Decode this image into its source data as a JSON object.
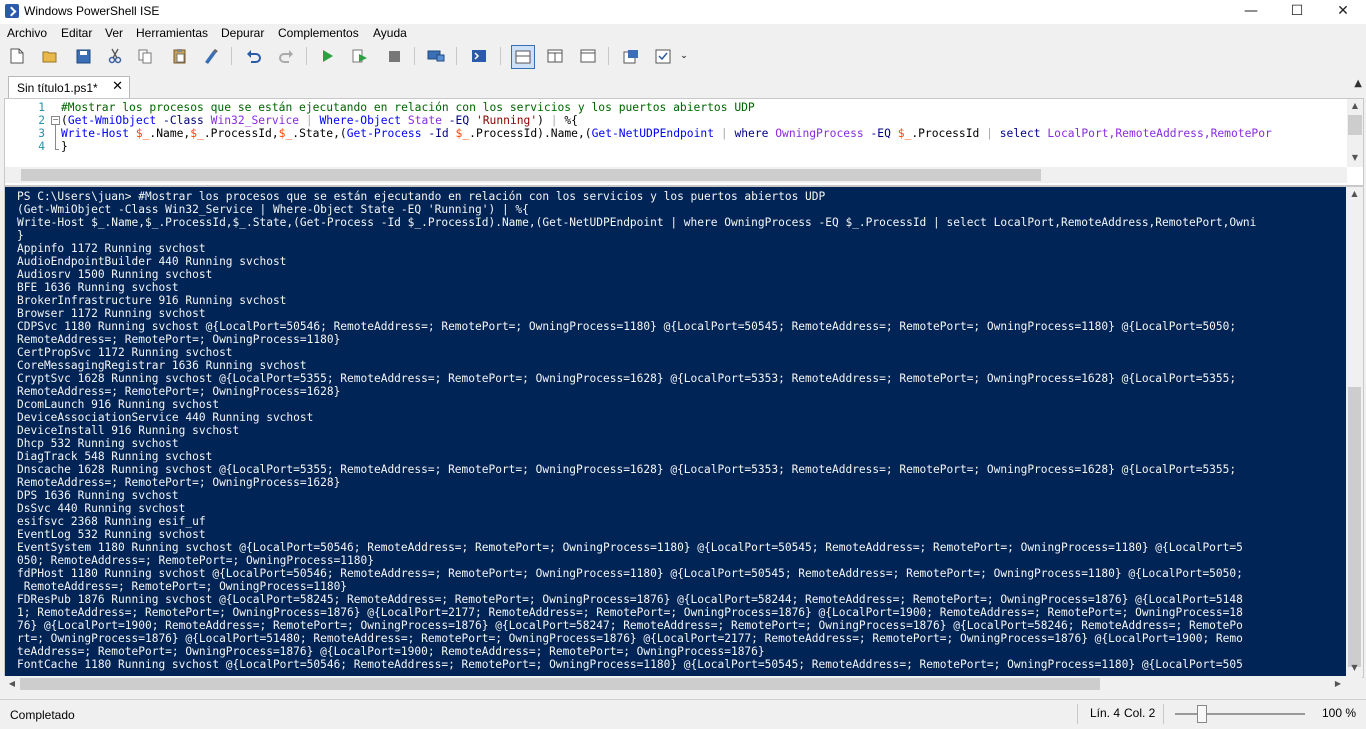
{
  "window": {
    "title": "Windows PowerShell ISE",
    "minimize": "—",
    "maximize": "☐",
    "close": "✕"
  },
  "menu": [
    "Archivo",
    "Editar",
    "Ver",
    "Herramientas",
    "Depurar",
    "Complementos",
    "Ayuda"
  ],
  "toolbar_icons": [
    "new-icon",
    "open-icon",
    "save-icon",
    "cut-icon",
    "copy-icon",
    "paste-icon",
    "clear-icon",
    "undo-icon",
    "redo-icon",
    "run-icon",
    "run-selection-icon",
    "stop-icon",
    "remote-icon",
    "powershell-icon",
    "layout-top-icon",
    "layout-right-icon",
    "layout-max-icon",
    "snippet-icon",
    "addon-icon",
    "overflow-icon"
  ],
  "tab": {
    "label": "Sin título1.ps1*",
    "close": "✕"
  },
  "editor": {
    "line_numbers": [
      "1",
      "2",
      "3",
      "4"
    ],
    "line1": "#Mostrar los procesos que se están ejecutando en relación con los servicios y los puertos abiertos UDP",
    "line2": {
      "open": "(",
      "cmd1": "Get-WmiObject",
      "param1": " -Class ",
      "arg1": "Win32_Service",
      "pipe1": " | ",
      "cmd2": "Where-Object",
      "arg2": " State ",
      "param2": "-EQ ",
      "str": "'Running'",
      "close": ")",
      "pipe2": " | ",
      "brace": "%{"
    },
    "line3": {
      "cmd": "Write-Host",
      "v1": " $_",
      "p1": ".Name,",
      "v2": "$_",
      "p2": ".ProcessId,",
      "v3": "$_",
      "p3": ".State,(",
      "cmd2": "Get-Process",
      "param": " -Id ",
      "v4": "$_",
      "p4": ".ProcessId).Name,(",
      "cmd3": "Get-NetUDPEndpoint",
      "pipe": " | ",
      "kw": "where",
      "arg": " OwningProcess ",
      "param2": "-EQ ",
      "v5": "$_",
      "p5": ".ProcessId",
      "pipe2": " | ",
      "kw2": "select",
      "arg2": " LocalPort,RemoteAddress,RemotePor"
    },
    "line4": "}"
  },
  "console": {
    "lines": [
      "PS C:\\Users\\juan> #Mostrar los procesos que se están ejecutando en relación con los servicios y los puertos abiertos UDP",
      "(Get-WmiObject -Class Win32_Service | Where-Object State -EQ 'Running') | %{",
      "Write-Host $_.Name,$_.ProcessId,$_.State,(Get-Process -Id $_.ProcessId).Name,(Get-NetUDPEndpoint | where OwningProcess -EQ $_.ProcessId | select LocalPort,RemoteAddress,RemotePort,Owni",
      "}",
      "Appinfo 1172 Running svchost",
      "AudioEndpointBuilder 440 Running svchost",
      "Audiosrv 1500 Running svchost",
      "BFE 1636 Running svchost",
      "BrokerInfrastructure 916 Running svchost",
      "Browser 1172 Running svchost",
      "CDPSvc 1180 Running svchost @{LocalPort=50546; RemoteAddress=; RemotePort=; OwningProcess=1180} @{LocalPort=50545; RemoteAddress=; RemotePort=; OwningProcess=1180} @{LocalPort=5050;",
      "RemoteAddress=; RemotePort=; OwningProcess=1180}",
      "CertPropSvc 1172 Running svchost",
      "CoreMessagingRegistrar 1636 Running svchost",
      "CryptSvc 1628 Running svchost @{LocalPort=5355; RemoteAddress=; RemotePort=; OwningProcess=1628} @{LocalPort=5353; RemoteAddress=; RemotePort=; OwningProcess=1628} @{LocalPort=5355;",
      "RemoteAddress=; RemotePort=; OwningProcess=1628}",
      "DcomLaunch 916 Running svchost",
      "DeviceAssociationService 440 Running svchost",
      "DeviceInstall 916 Running svchost",
      "Dhcp 532 Running svchost",
      "DiagTrack 548 Running svchost",
      "Dnscache 1628 Running svchost @{LocalPort=5355; RemoteAddress=; RemotePort=; OwningProcess=1628} @{LocalPort=5353; RemoteAddress=; RemotePort=; OwningProcess=1628} @{LocalPort=5355;",
      "RemoteAddress=; RemotePort=; OwningProcess=1628}",
      "DPS 1636 Running svchost",
      "DsSvc 440 Running svchost",
      "esifsvc 2368 Running esif_uf",
      "EventLog 532 Running svchost",
      "EventSystem 1180 Running svchost @{LocalPort=50546; RemoteAddress=; RemotePort=; OwningProcess=1180} @{LocalPort=50545; RemoteAddress=; RemotePort=; OwningProcess=1180} @{LocalPort=5",
      "050; RemoteAddress=; RemotePort=; OwningProcess=1180}",
      "fdPHost 1180 Running svchost @{LocalPort=50546; RemoteAddress=; RemotePort=; OwningProcess=1180} @{LocalPort=50545; RemoteAddress=; RemotePort=; OwningProcess=1180} @{LocalPort=5050;",
      " RemoteAddress=; RemotePort=; OwningProcess=1180}",
      "FDResPub 1876 Running svchost @{LocalPort=58245; RemoteAddress=; RemotePort=; OwningProcess=1876} @{LocalPort=58244; RemoteAddress=; RemotePort=; OwningProcess=1876} @{LocalPort=5148",
      "1; RemoteAddress=; RemotePort=; OwningProcess=1876} @{LocalPort=2177; RemoteAddress=; RemotePort=; OwningProcess=1876} @{LocalPort=1900; RemoteAddress=; RemotePort=; OwningProcess=18",
      "76} @{LocalPort=1900; RemoteAddress=; RemotePort=; OwningProcess=1876} @{LocalPort=58247; RemoteAddress=; RemotePort=; OwningProcess=1876} @{LocalPort=58246; RemoteAddress=; RemotePo",
      "rt=; OwningProcess=1876} @{LocalPort=51480; RemoteAddress=; RemotePort=; OwningProcess=1876} @{LocalPort=2177; RemoteAddress=; RemotePort=; OwningProcess=1876} @{LocalPort=1900; Remo",
      "teAddress=; RemotePort=; OwningProcess=1876} @{LocalPort=1900; RemoteAddress=; RemotePort=; OwningProcess=1876}",
      "FontCache 1180 Running svchost @{LocalPort=50546; RemoteAddress=; RemotePort=; OwningProcess=1180} @{LocalPort=50545; RemoteAddress=; RemotePort=; OwningProcess=1180} @{LocalPort=505"
    ]
  },
  "status": {
    "text": "Completado",
    "line": "Lín. 4",
    "col": "Col. 2",
    "zoom": "100 %",
    "zoom_level": 0.2
  },
  "colors": {
    "console_bg": "#012456",
    "console_fg": "#f5f5f5"
  }
}
